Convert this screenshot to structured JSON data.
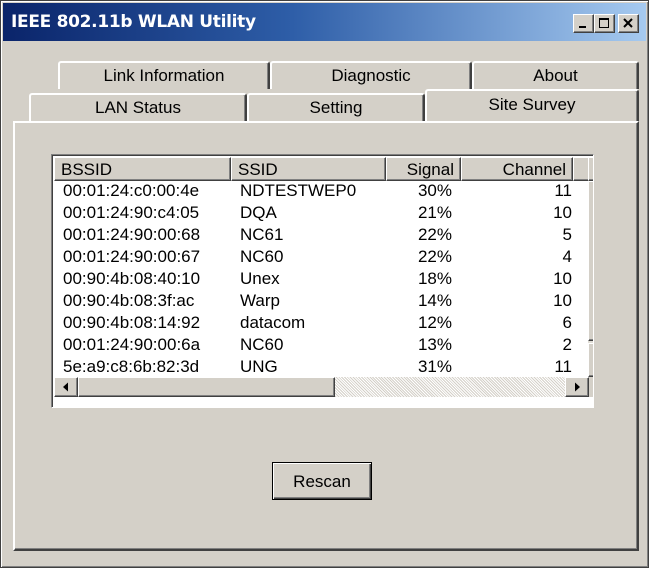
{
  "window": {
    "title": "IEEE 802.11b WLAN Utility"
  },
  "tabs": {
    "back_row": [
      "Link Information",
      "Diagnostic",
      "About"
    ],
    "front_row": [
      "LAN Status",
      "Setting",
      "Site Survey"
    ],
    "active": "Site Survey"
  },
  "site_survey": {
    "columns": [
      "BSSID",
      "SSID",
      "Signal",
      "Channel"
    ],
    "rows": [
      {
        "bssid": "00:01:24:c0:00:4e",
        "ssid": "NDTESTWEP0",
        "signal": "30%",
        "channel": "11"
      },
      {
        "bssid": "00:01:24:90:c4:05",
        "ssid": "DQA",
        "signal": "21%",
        "channel": "10"
      },
      {
        "bssid": "00:01:24:90:00:68",
        "ssid": "NC61",
        "signal": "22%",
        "channel": "5"
      },
      {
        "bssid": "00:01:24:90:00:67",
        "ssid": "NC60",
        "signal": "22%",
        "channel": "4"
      },
      {
        "bssid": "00:90:4b:08:40:10",
        "ssid": "Unex",
        "signal": "18%",
        "channel": "10"
      },
      {
        "bssid": "00:90:4b:08:3f:ac",
        "ssid": "Warp",
        "signal": "14%",
        "channel": "10"
      },
      {
        "bssid": "00:90:4b:08:14:92",
        "ssid": "datacom",
        "signal": "12%",
        "channel": "6"
      },
      {
        "bssid": "00:01:24:90:00:6a",
        "ssid": "NC60",
        "signal": "13%",
        "channel": "2"
      },
      {
        "bssid": "5e:a9:c8:6b:82:3d",
        "ssid": "UNG",
        "signal": "31%",
        "channel": "11"
      }
    ],
    "rescan_label": "Rescan"
  },
  "icons": {
    "minimize": "minimize-icon",
    "maximize": "maximize-icon",
    "close": "close-icon",
    "scroll_up": "arrow-up-icon",
    "scroll_down": "arrow-down-icon",
    "scroll_left": "arrow-left-icon",
    "scroll_right": "arrow-right-icon"
  },
  "colors": {
    "title_bar_start": "#0a246a",
    "title_bar_end": "#a6caf0",
    "face": "#d4d0c8"
  }
}
